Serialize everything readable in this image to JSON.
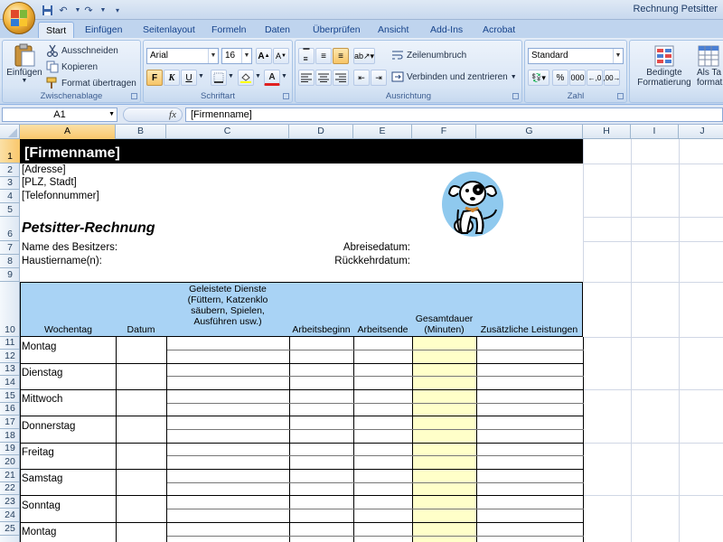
{
  "window": {
    "title": "Rechnung Petsitter"
  },
  "tabs": [
    "Start",
    "Einfügen",
    "Seitenlayout",
    "Formeln",
    "Daten",
    "Überprüfen",
    "Ansicht",
    "Add-Ins",
    "Acrobat"
  ],
  "ribbon": {
    "clipboard": {
      "paste": "Einfügen",
      "cut": "Ausschneiden",
      "copy": "Kopieren",
      "format_painter": "Format übertragen",
      "label": "Zwischenablage"
    },
    "font": {
      "name": "Arial",
      "size": "16",
      "bold": "F",
      "italic": "K",
      "underline": "U",
      "label": "Schriftart"
    },
    "alignment": {
      "wrap": "Zeilenumbruch",
      "merge": "Verbinden und zentrieren",
      "label": "Ausrichtung"
    },
    "number": {
      "format": "Standard",
      "percent": "%",
      "thousands": "000",
      "label": "Zahl"
    },
    "styles": {
      "conditional": "Bedingte",
      "conditional2": "Formatierung",
      "table": "Als Ta",
      "table2": "formatie"
    }
  },
  "formula_bar": {
    "name_box": "A1",
    "fx": "fx",
    "content": "[Firmenname]"
  },
  "columns": [
    "A",
    "B",
    "C",
    "D",
    "E",
    "F",
    "G",
    "H",
    "I",
    "J"
  ],
  "rows": [
    "1",
    "2",
    "3",
    "4",
    "5",
    "6",
    "7",
    "8",
    "9",
    "10",
    "11",
    "12",
    "13",
    "14",
    "15",
    "16",
    "17",
    "18",
    "19",
    "20",
    "21",
    "22",
    "23",
    "24",
    "25"
  ],
  "sheet": {
    "company": "[Firmenname]",
    "address": "[Adresse]",
    "city": "[PLZ, Stadt]",
    "phone": "[Telefonnummer]",
    "invoice_title": "Petsitter-Rechnung",
    "owner_label": "Name des Besitzers:",
    "pet_label": "Haustiername(n):",
    "departure_label": "Abreisedatum:",
    "return_label": "Rückkehrdatum:",
    "headers": {
      "weekday": "Wochentag",
      "date": "Datum",
      "services": "Geleistete Dienste (Füttern, Katzenklo säubern, Spielen, Ausführen usw.)",
      "start": "Arbeitsbeginn",
      "end": "Arbeitsende",
      "duration": "Gesamtdauer (Minuten)",
      "extras": "Zusätzliche Leistungen"
    },
    "days": [
      "Montag",
      "Dienstag",
      "Mittwoch",
      "Donnerstag",
      "Freitag",
      "Samstag",
      "Sonntag",
      "Montag"
    ]
  },
  "colors": {
    "header_fill": "#a9d3f5",
    "duration_fill": "#ffffc9",
    "banner": "#000000",
    "accent": "#15428b"
  }
}
